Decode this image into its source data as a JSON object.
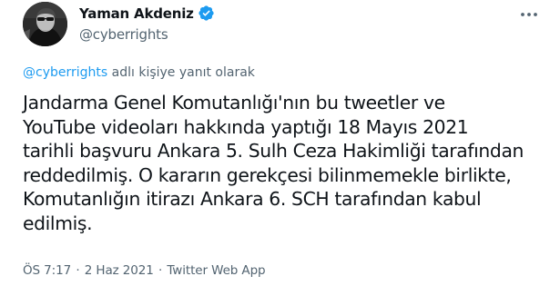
{
  "author": {
    "display_name": "Yaman Akdeniz",
    "handle": "@cyberrights",
    "avatar_icon": "profile-photo",
    "verified_icon": "verified-badge-icon",
    "verified_color": "#1d9bf0"
  },
  "more_icon": "more-horizontal-icon",
  "reply_context": {
    "mention": "@cyberrights",
    "text": " adlı kişiye yanıt olarak"
  },
  "tweet": {
    "lines": [
      "Jandarma Genel Komutanlığı'nın bu tweetler ve",
      "YouTube videoları hakkında yaptığı 18 Mayıs 2021",
      "tarihli başvuru Ankara 5. Sulh Ceza Hakimliği tarafından",
      "reddedilmiş. O kararın gerekçesi bilinmemekle birlikte,",
      "Komutanlığın itirazı Ankara 6. SCH tarafından kabul",
      "edilmiş."
    ]
  },
  "meta": {
    "time": "ÖS 7:17",
    "separator": "·",
    "date": "2 Haz 2021",
    "source": "Twitter Web App"
  },
  "colors": {
    "text": "#0f1419",
    "secondary": "#536471",
    "accent": "#1d9bf0"
  }
}
